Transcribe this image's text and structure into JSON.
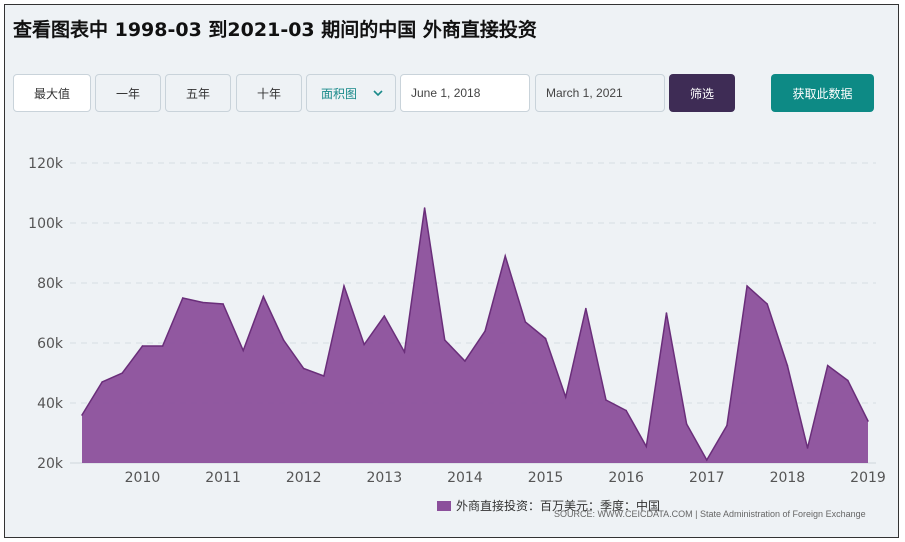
{
  "header": {
    "title": "查看图表中 1998-03 到2021-03 期间的中国 外商直接投资"
  },
  "controls": {
    "range_buttons": [
      "最大值",
      "一年",
      "五年",
      "十年"
    ],
    "chart_type": "面积图",
    "start_date": "June 1, 2018",
    "end_date": "March 1, 2021",
    "filter_label": "筛选",
    "get_data_label": "获取此数据"
  },
  "legend": {
    "label": "外商直接投资：百万美元：季度：中国"
  },
  "source": "SOURCE: WWW.CEICDATA.COM | State Administration of Foreign Exchange",
  "colors": {
    "area_fill": "#8b4f9b",
    "area_stroke": "#6a2e7a",
    "filter_button": "#3e2c55",
    "get_data_button": "#0d8a85"
  },
  "chart_data": {
    "type": "area",
    "title": "",
    "xlabel": "",
    "ylabel": "",
    "ylim": [
      20000,
      120000
    ],
    "y_ticks": [
      20000,
      40000,
      60000,
      80000,
      100000,
      120000
    ],
    "y_tick_labels": [
      "20k",
      "40k",
      "60k",
      "80k",
      "100k",
      "120k"
    ],
    "x_tick_labels": [
      "2010",
      "2011",
      "2012",
      "2013",
      "2014",
      "2015",
      "2016",
      "2017",
      "2018",
      "2019"
    ],
    "grid": true,
    "legend_position": "bottom",
    "x": [
      "2009-09",
      "2009-12",
      "2010-03",
      "2010-06",
      "2010-09",
      "2010-12",
      "2011-03",
      "2011-06",
      "2011-09",
      "2011-12",
      "2012-03",
      "2012-06",
      "2012-09",
      "2012-12",
      "2013-03",
      "2013-06",
      "2013-09",
      "2013-12",
      "2014-03",
      "2014-06",
      "2014-09",
      "2014-12",
      "2015-03",
      "2015-06",
      "2015-09",
      "2015-12",
      "2016-03",
      "2016-06",
      "2016-09",
      "2016-12",
      "2017-03",
      "2017-06",
      "2017-09",
      "2017-12",
      "2018-03",
      "2018-06",
      "2018-09",
      "2018-12",
      "2019-03",
      "2019-06",
      "2019-09"
    ],
    "series": [
      {
        "name": "外商直接投资：百万美元：季度：中国",
        "values": [
          36000,
          47000,
          50000,
          59000,
          59000,
          75000,
          73500,
          73000,
          57500,
          75500,
          61000,
          51500,
          49000,
          79000,
          59500,
          69000,
          57000,
          105000,
          61000,
          54000,
          64000,
          89000,
          67000,
          61500,
          42000,
          71500,
          41000,
          37500,
          25500,
          70000,
          33000,
          21000,
          32500,
          79000,
          73000,
          52500,
          25000,
          52500,
          47500,
          34000
        ]
      }
    ]
  }
}
